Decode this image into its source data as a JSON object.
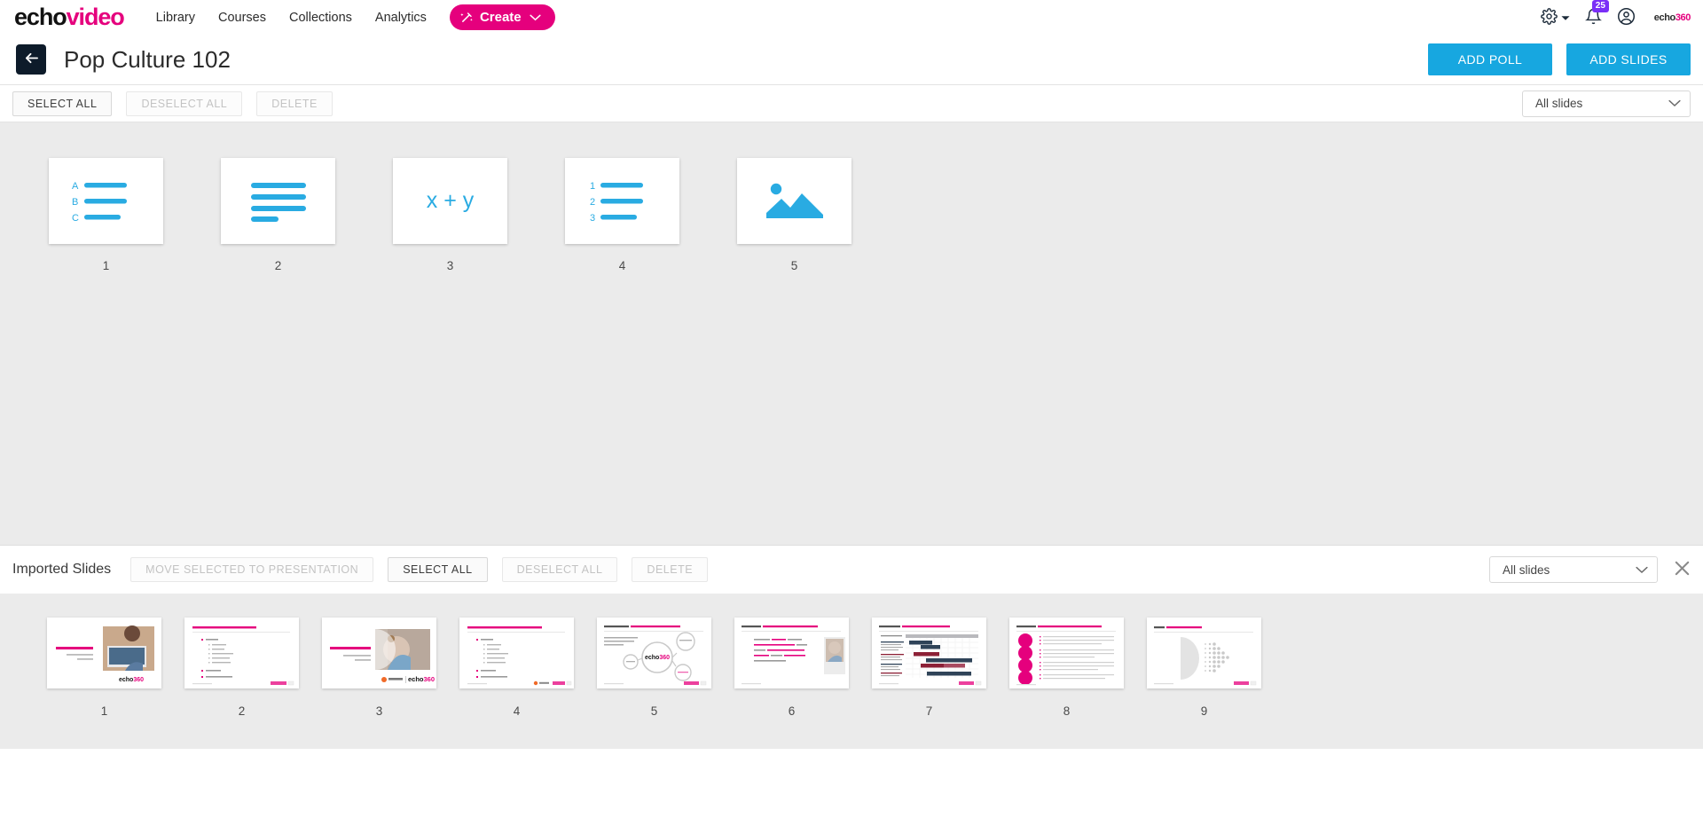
{
  "nav": {
    "brand_echo": "echo",
    "brand_video": "video",
    "links": [
      {
        "label": "Library",
        "name": "nav-link-library"
      },
      {
        "label": "Courses",
        "name": "nav-link-courses"
      },
      {
        "label": "Collections",
        "name": "nav-link-collections"
      },
      {
        "label": "Analytics",
        "name": "nav-link-analytics"
      }
    ],
    "create_label": "Create",
    "notification_count": "25",
    "corp_logo_a": "echo",
    "corp_logo_b": "360",
    "icons": [
      "wand-icon",
      "chevron-down-icon",
      "gear-icon",
      "bell-icon",
      "user-avatar-icon"
    ],
    "accent_pink": "#e5007d",
    "badge_purple": "#7b2ff7"
  },
  "header": {
    "title": "Pop Culture 102",
    "back_icon": "arrow-left-icon",
    "add_poll_label": "ADD POLL",
    "add_slides_label": "ADD SLIDES",
    "button_blue": "#17a7e0"
  },
  "toolbar": {
    "select_all": "SELECT ALL",
    "deselect_all": "DESELECT ALL",
    "delete": "DELETE",
    "filter_value": "All slides"
  },
  "presentation_slides": [
    {
      "number": "1",
      "type": "multiple-choice",
      "labels": [
        "A",
        "B",
        "C"
      ]
    },
    {
      "number": "2",
      "type": "text-lines"
    },
    {
      "number": "3",
      "type": "equation",
      "text": "x + y"
    },
    {
      "number": "4",
      "type": "numbered-list",
      "labels": [
        "1",
        "2",
        "3"
      ]
    },
    {
      "number": "5",
      "type": "image-placeholder"
    }
  ],
  "imported": {
    "label": "Imported Slides",
    "move_selected": "MOVE SELECTED TO PRESENTATION",
    "select_all": "SELECT ALL",
    "deselect_all": "DESELECT ALL",
    "delete": "DELETE",
    "filter_value": "All slides",
    "close_icon": "close-icon",
    "slides": [
      {
        "number": "1",
        "kind": "title-photo",
        "title": "SOLO PRESENTATION TITLE",
        "subtitle": "SUBTITLE GOES HERE IN CAPS",
        "date": "Date here 2022",
        "footer_logo": "echo360"
      },
      {
        "number": "2",
        "kind": "bullets",
        "title": "SOLO DISCUSSION GUIDE (NOTICE FOOTER)",
        "bullets": [
          "Update",
          "Timetable",
          "Initiatives",
          "Customer Feedback",
          "Product Strategy",
          "Experimentation",
          "2022 Budget",
          "Highlights & Next Steps"
        ]
      },
      {
        "number": "3",
        "kind": "title-photo-partner",
        "title": "PARTNER PRESENTATION TITLE",
        "subtitle": "SUBTITLE GOES HERE IN CAPS",
        "date": "Date here 2022",
        "footer_logo": "Spyglass  echo360"
      },
      {
        "number": "4",
        "kind": "bullets",
        "title": "PARTNER DISCUSSION GUIDE (NOTICE FOOTER)",
        "bullets": [
          "Update",
          "Timetable",
          "Initiatives",
          "Customer Feedback",
          "Product Strategy",
          "Experimentation",
          "2022 Budget",
          "Highlights & Next Steps"
        ]
      },
      {
        "number": "5",
        "kind": "infographic",
        "title_prefix": "ROADMAP & PRODUCT",
        "title_accent": "EXAMPLE OF INFOGRAPHIC AND TEXT",
        "center_logo": "echo360"
      },
      {
        "number": "6",
        "kind": "text-photo",
        "title_prefix": "OUR IDENTITY",
        "title_accent": "EXAMPLE OF INNERBODY TEXT AND PHOTO",
        "body": "Echo360 is the innovator who enables the transformation of inspired learning by making it more engaging, equitable and evidence-driven — unlocking the growth potential of organizations and people."
      },
      {
        "number": "7",
        "kind": "gantt",
        "title_prefix": "INTEGRATION",
        "title_accent": "EXAMPLE OF IMAGE WITHOUT TEXT"
      },
      {
        "number": "8",
        "kind": "categories",
        "title_prefix": "HIGHLIGHTS",
        "title_accent": "EXAMPLE OF BULLET POINTS WITHIN CATEGORIES"
      },
      {
        "number": "9",
        "kind": "graphics",
        "title_prefix": "MISC",
        "title_accent": "GRAPHIC ELEMENTS"
      }
    ]
  }
}
